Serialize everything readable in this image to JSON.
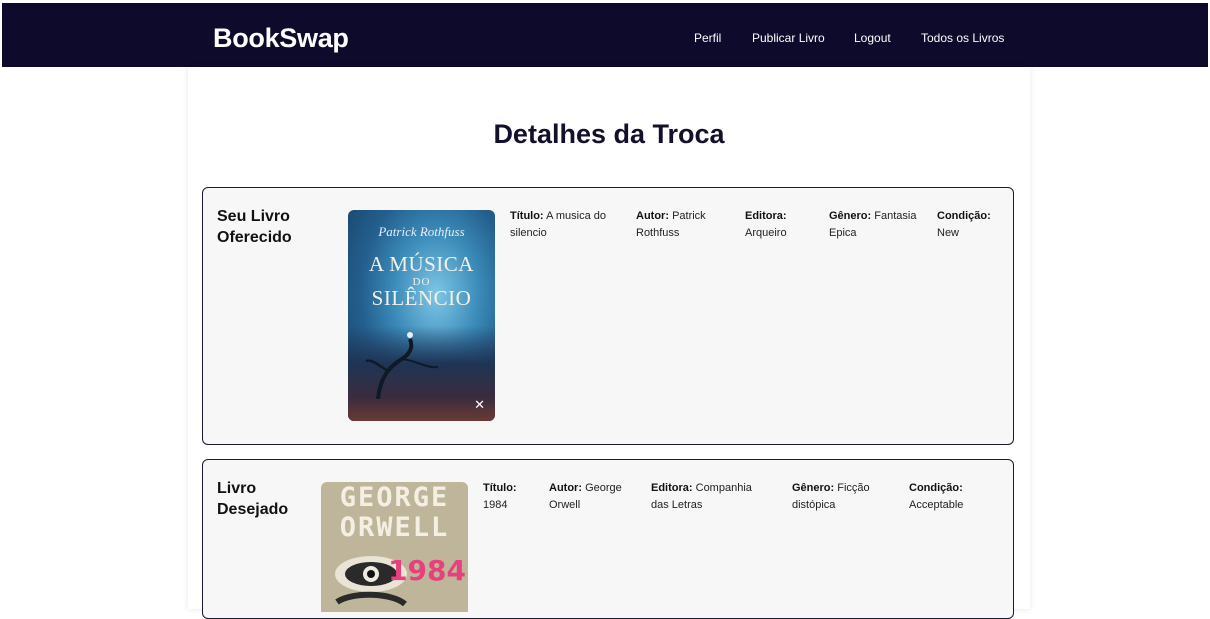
{
  "header": {
    "brand": "BookSwap",
    "nav": [
      "Perfil",
      "Publicar Livro",
      "Logout",
      "Todos os Livros"
    ]
  },
  "page": {
    "title": "Detalhes da Troca"
  },
  "offered": {
    "heading": "Seu Livro Oferecido",
    "cover": {
      "author": "Patrick Rothfuss",
      "title_line1": "A MÚSICA",
      "title_line2": "DO",
      "title_line3": "SILÊNCIO"
    },
    "fields": [
      {
        "label": "Título:",
        "value": "A musica do silencio"
      },
      {
        "label": "Autor:",
        "value": "Patrick Rothfuss"
      },
      {
        "label": "Editora:",
        "value": "Arqueiro"
      },
      {
        "label": "Gênero:",
        "value": "Fantasia Epica"
      },
      {
        "label": "Condição:",
        "value": "New"
      }
    ]
  },
  "wanted": {
    "heading": "Livro Desejado",
    "cover": {
      "line1": "GEORGE",
      "line2": "ORWELL",
      "number": "1984"
    },
    "fields": [
      {
        "label": "Título:",
        "value": "1984"
      },
      {
        "label": "Autor:",
        "value": "George Orwell"
      },
      {
        "label": "Editora:",
        "value": "Companhia das Letras"
      },
      {
        "label": "Gênero:",
        "value": "Ficção distópica"
      },
      {
        "label": "Condição:",
        "value": "Acceptable"
      }
    ]
  },
  "colors": {
    "navbar": "#0d0a2b",
    "card_border": "#1a1a2e",
    "card_bg": "#f7f7f7"
  }
}
